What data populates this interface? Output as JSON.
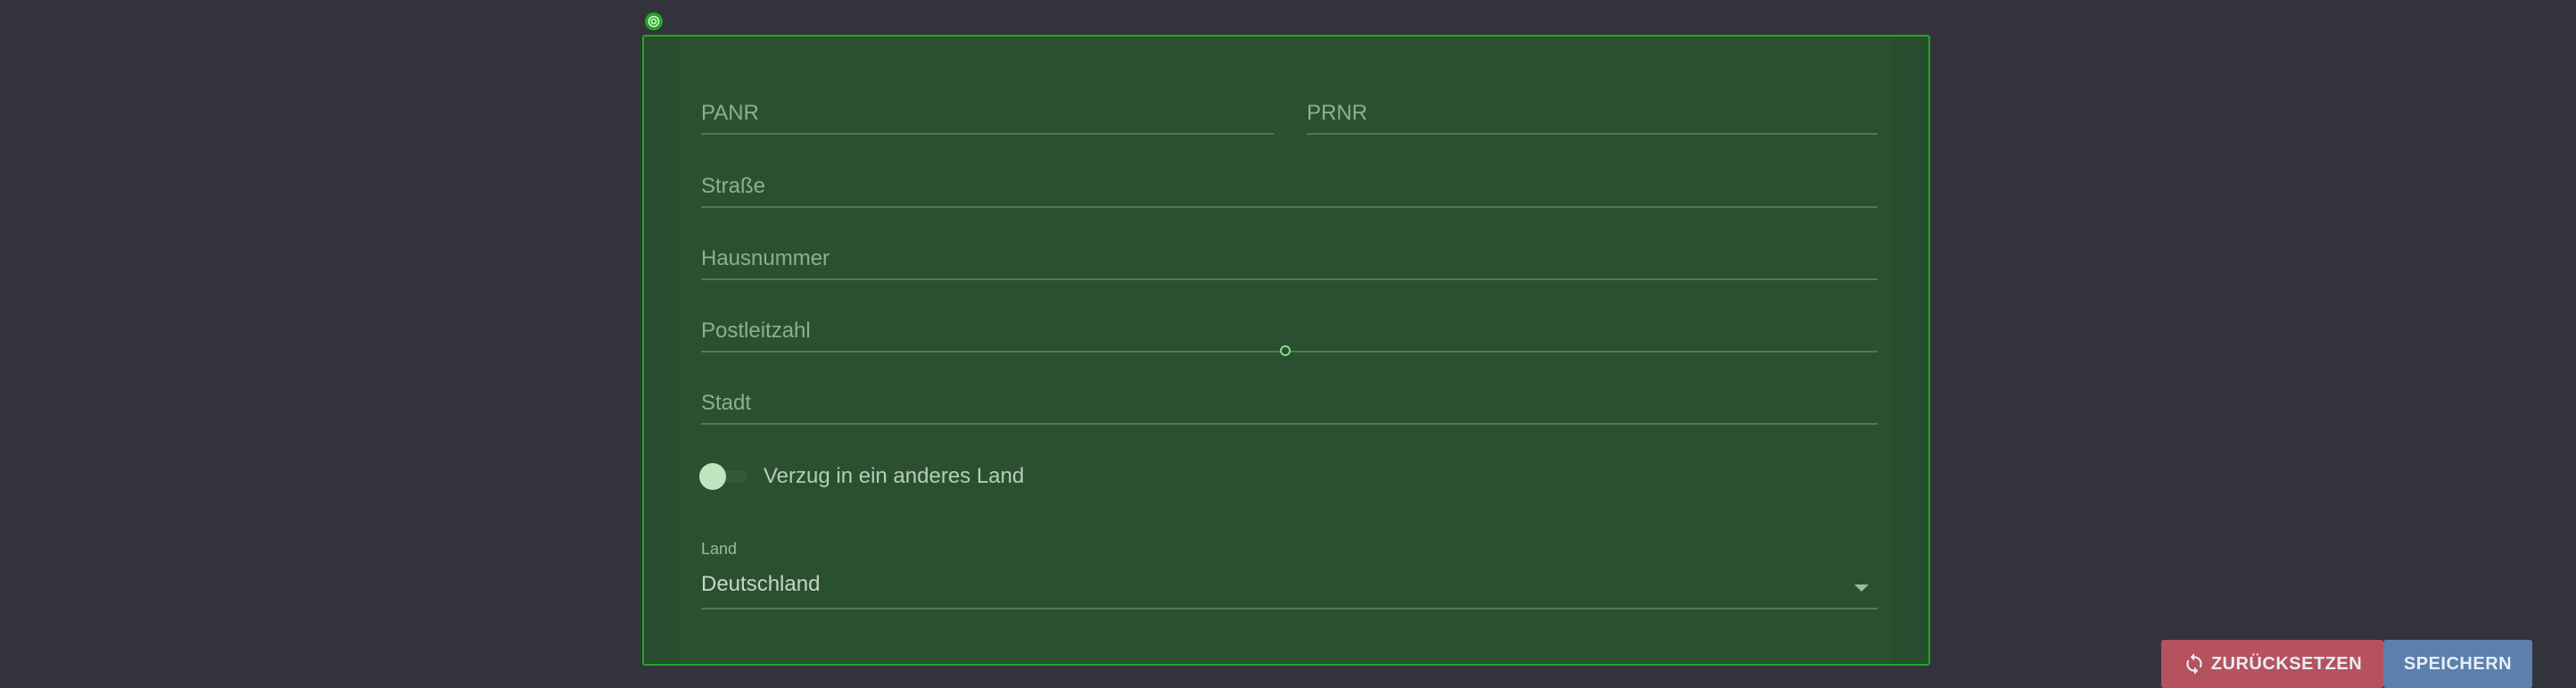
{
  "form": {
    "fields": {
      "panr": {
        "placeholder": "PANR"
      },
      "prnr": {
        "placeholder": "PRNR"
      },
      "strasse": {
        "placeholder": "Straße"
      },
      "hausnummer": {
        "placeholder": "Hausnummer"
      },
      "postleitzahl": {
        "placeholder": "Postleitzahl"
      },
      "stadt": {
        "placeholder": "Stadt"
      }
    },
    "toggle": {
      "label": "Verzug in ein anderes Land",
      "checked": false
    },
    "country": {
      "label": "Land",
      "value": "Deutschland"
    },
    "actions": {
      "reset_label": "ZURÜCKSETZEN",
      "save_label": "SPEICHERN"
    }
  },
  "icons": {
    "reset": "refresh-icon",
    "badge": "target-icon",
    "dropdown": "caret-down-icon"
  },
  "colors": {
    "page_background": "#33333b",
    "panel_background": "#2a5030",
    "panel_border": "#1fa81f",
    "reset_button": "#b5525e",
    "save_button": "#5c7faf"
  }
}
